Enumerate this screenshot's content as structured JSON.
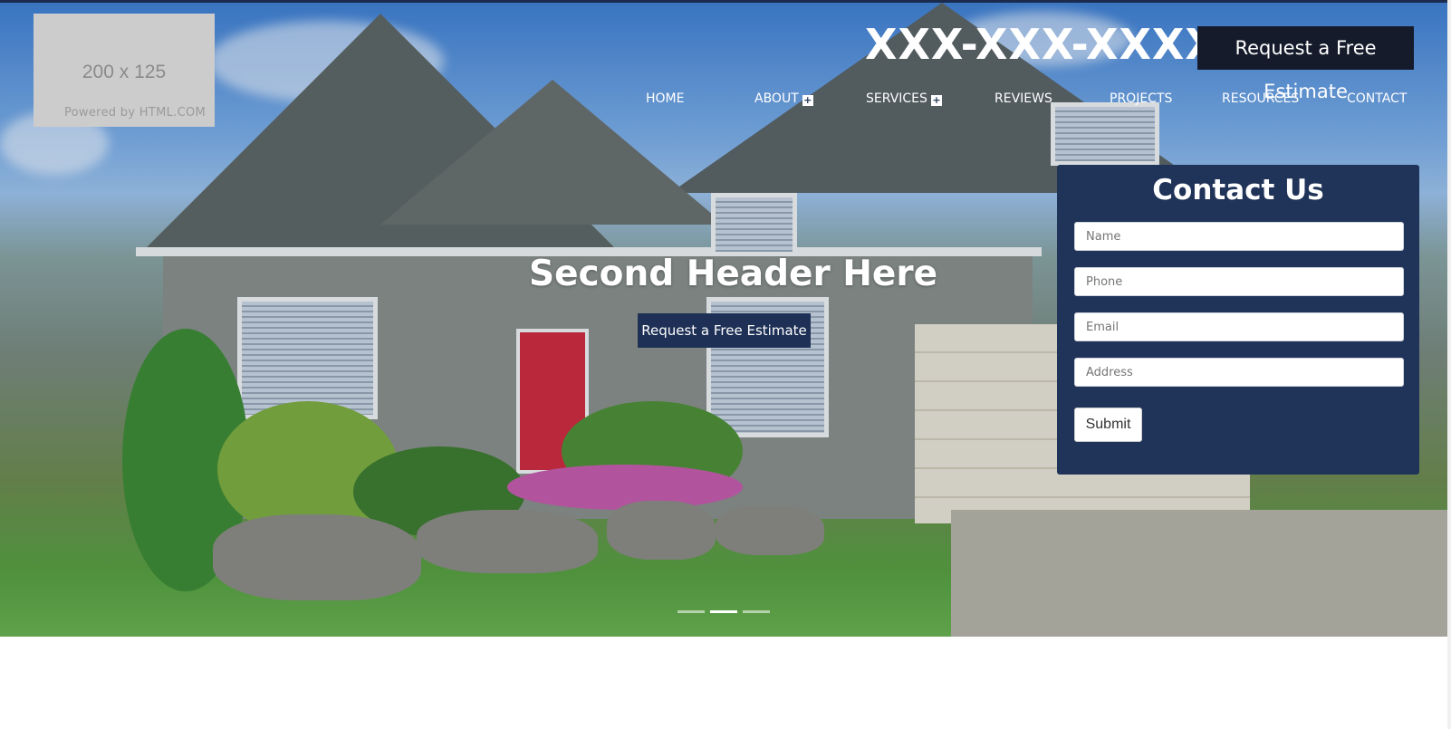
{
  "logo": {
    "size_text": "200 x 125",
    "powered_text": "Powered by HTML.COM"
  },
  "header": {
    "phone": "XXX-XXX-XXXX",
    "estimate_button": "Request a Free Estimate"
  },
  "nav": {
    "items": [
      {
        "label": "HOME",
        "has_submenu": false
      },
      {
        "label": "ABOUT",
        "has_submenu": true
      },
      {
        "label": "SERVICES",
        "has_submenu": true
      },
      {
        "label": "REVIEWS",
        "has_submenu": false
      },
      {
        "label": "PROJECTS",
        "has_submenu": false
      },
      {
        "label": "RESOURCES",
        "has_submenu": false
      },
      {
        "label": "CONTACT",
        "has_submenu": false
      }
    ],
    "submenu_glyph": "+"
  },
  "hero": {
    "headline": "Second Header Here",
    "estimate_button": "Request a Free Estimate",
    "slides_total": 3,
    "active_slide": 2
  },
  "contact_form": {
    "title": "Contact Us",
    "fields": [
      {
        "placeholder": "Name"
      },
      {
        "placeholder": "Phone"
      },
      {
        "placeholder": "Email"
      },
      {
        "placeholder": "Address"
      }
    ],
    "submit_label": "Submit"
  },
  "colors": {
    "navy": "#203358",
    "dark_button": "#151b2b",
    "white": "#ffffff"
  },
  "icons": {
    "submenu": "plus-box-icon"
  }
}
